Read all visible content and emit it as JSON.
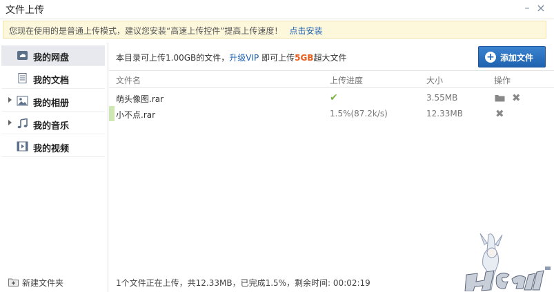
{
  "window": {
    "title": "文件上传",
    "minimize_glyph": "–",
    "close_glyph": "×"
  },
  "notice": {
    "text": "您现在使用的是普通上传模式，建议您安装“高速上传控件”提高上传速度！",
    "link": "点击安装"
  },
  "sidebar": {
    "items": [
      {
        "label": "我的网盘",
        "icon": "cloud-drive-icon",
        "active": true
      },
      {
        "label": "我的文档",
        "icon": "document-icon"
      },
      {
        "label": "我的相册",
        "icon": "photo-icon",
        "expandable": true
      },
      {
        "label": "我的音乐",
        "icon": "music-note-icon",
        "expandable": true
      },
      {
        "label": "我的视频",
        "icon": "video-icon"
      }
    ],
    "new_folder": "新建文件夹"
  },
  "main": {
    "quota_prefix": "本目录可上传1.00GB的文件，",
    "quota_upgrade": "升级VIP",
    "quota_mid": " 即可上传",
    "quota_big": "5GB",
    "quota_suffix": "超大文件",
    "add_button": "添加文件",
    "columns": {
      "name": "文件名",
      "progress": "上传进度",
      "size": "大小",
      "actions": "操作"
    },
    "files": [
      {
        "name": "萌头像图.rar",
        "progress": "",
        "status": "completed",
        "size": "3.55MB"
      },
      {
        "name": "小不点.rar",
        "progress": "1.5%(87.2k/s)",
        "status": "uploading",
        "size": "12.33MB"
      }
    ],
    "status_bar": "1个文件正在上传，共12.33MB，已完成1.5%，剩余时间: 00:02:19"
  },
  "colors": {
    "accent": "#1f63b0",
    "notice_bg": "#fdf8dc",
    "highlight": "#e65c1a",
    "success": "#79b541"
  }
}
